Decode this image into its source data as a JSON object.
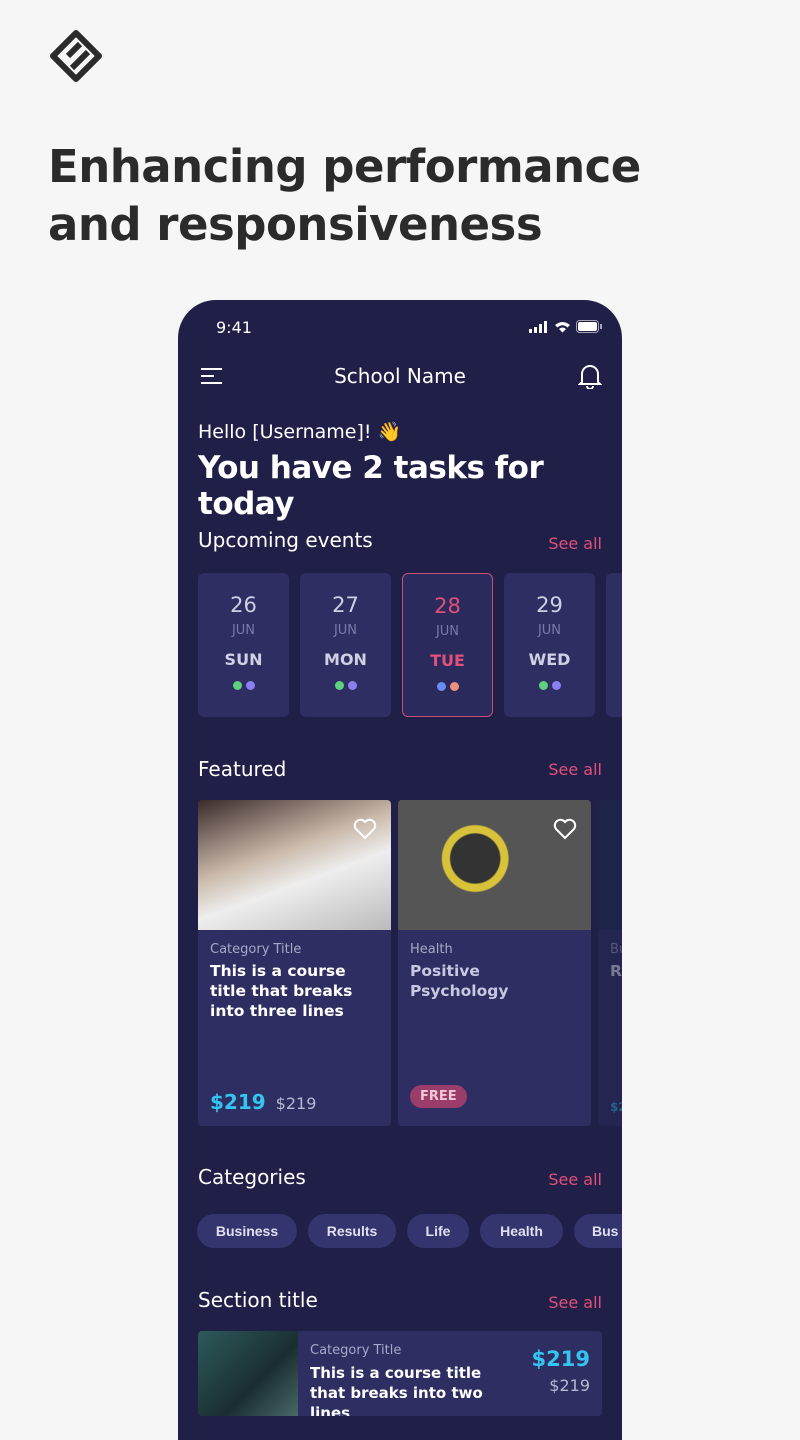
{
  "headline": "Enhancing performance and responsiveness",
  "phone": {
    "status_time": "9:41",
    "header": {
      "title": "School Name",
      "menu_icon": "hamburger-icon",
      "bell_icon": "bell-icon"
    },
    "greeting": "Hello [Username]! 👋",
    "tasks": "You have 2 tasks for today",
    "upcoming": {
      "title": "Upcoming events",
      "see_all": "See all",
      "days": [
        {
          "num": "26",
          "month": "JUN",
          "name": "SUN",
          "dots": [
            "#5fcf80",
            "#8a80f0"
          ],
          "selected": false
        },
        {
          "num": "27",
          "month": "JUN",
          "name": "MON",
          "dots": [
            "#5fcf80",
            "#8a80f0"
          ],
          "selected": false
        },
        {
          "num": "28",
          "month": "JUN",
          "name": "TUE",
          "dots": [
            "#6a8cf5",
            "#f0907a"
          ],
          "selected": true
        },
        {
          "num": "29",
          "month": "JUN",
          "name": "WED",
          "dots": [
            "#5fcf80",
            "#8a80f0"
          ],
          "selected": false
        }
      ]
    },
    "featured": {
      "title": "Featured",
      "see_all": "See all",
      "cards": [
        {
          "category": "Category Title",
          "title": "This is a course title that breaks into three lines",
          "price": "$219",
          "old_price": "$219"
        },
        {
          "category": "Health",
          "title": "Positive Psychology",
          "badge": "FREE"
        },
        {
          "category": "Bu",
          "title": "Re ar",
          "price": "$2"
        }
      ]
    },
    "categories": {
      "title": "Categories",
      "see_all": "See all",
      "chips": [
        "Business",
        "Results",
        "Life",
        "Health",
        "Bus"
      ]
    },
    "section": {
      "title": "Section title",
      "see_all": "See all",
      "item": {
        "category": "Category Title",
        "title": "This is a course title that breaks into two lines",
        "price": "$219",
        "old_price": "$219"
      }
    },
    "accent_color": "#e0507a",
    "price_color": "#33c5ef"
  }
}
